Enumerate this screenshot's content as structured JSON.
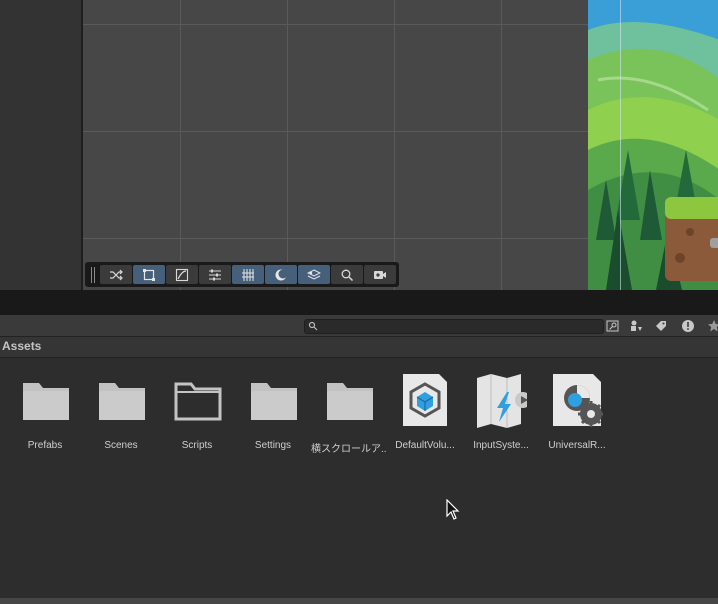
{
  "scene_toolbar": {
    "tools": [
      {
        "name": "shuffle-icon",
        "active": false
      },
      {
        "name": "rect-tool-icon",
        "active": true
      },
      {
        "name": "draw-tool-icon",
        "active": false
      },
      {
        "name": "settings-sliders-icon",
        "active": false
      },
      {
        "name": "grid-snap-icon",
        "active": true
      },
      {
        "name": "moon-icon",
        "active": true
      },
      {
        "name": "layers-icon",
        "active": true
      },
      {
        "name": "zoom-icon",
        "active": false
      },
      {
        "name": "camera-icon",
        "active": false
      }
    ]
  },
  "project": {
    "search_value": "",
    "breadcrumb": "Assets",
    "items": [
      {
        "label": "Prefabs",
        "type": "folder",
        "icon": "folder-icon"
      },
      {
        "label": "Scenes",
        "type": "folder",
        "icon": "folder-icon"
      },
      {
        "label": "Scripts",
        "type": "folder-empty",
        "icon": "empty-folder-icon"
      },
      {
        "label": "Settings",
        "type": "folder",
        "icon": "folder-icon"
      },
      {
        "label": "横スクロールア...",
        "type": "folder",
        "icon": "folder-icon"
      },
      {
        "label": "DefaultVolu...",
        "type": "volume-profile",
        "icon": "volume-profile-icon"
      },
      {
        "label": "InputSyste...",
        "type": "input-actions",
        "icon": "input-actions-icon"
      },
      {
        "label": "UniversalR...",
        "type": "render-pipeline",
        "icon": "render-pipeline-icon"
      }
    ]
  },
  "colors": {
    "active_tool": "#46607c",
    "panel_bg": "#2d2d2d",
    "accent_blue": "#2f9fe0"
  }
}
